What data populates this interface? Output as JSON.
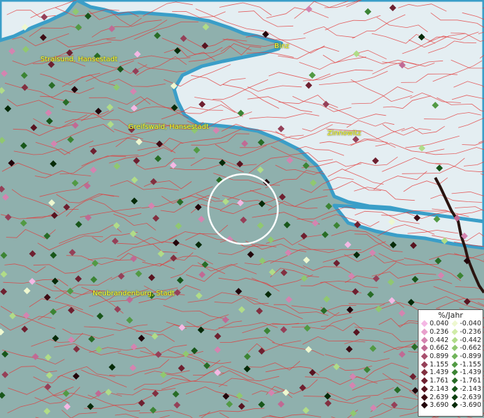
{
  "places": [
    {
      "name": "Stralsund, Hansestadt"
    },
    {
      "name": "Binz"
    },
    {
      "name": "Greifswald, Hansestadt"
    },
    {
      "name": "Zinnowitz"
    },
    {
      "name": "Neubrandenburg, Stadt"
    }
  ],
  "legend": {
    "title": "%/Jahr",
    "positive": [
      {
        "label": "0.040",
        "color": "#f4b8e4"
      },
      {
        "label": "0.236",
        "color": "#e8a0cc"
      },
      {
        "label": "0.442",
        "color": "#d484b0"
      },
      {
        "label": "0.662",
        "color": "#c06a94"
      },
      {
        "label": "0.899",
        "color": "#a8506e"
      },
      {
        "label": "1.155",
        "color": "#954058"
      },
      {
        "label": "1.439",
        "color": "#823040"
      },
      {
        "label": "1.761",
        "color": "#6e2030"
      },
      {
        "label": "2.143",
        "color": "#581420"
      },
      {
        "label": "2.639",
        "color": "#3e0c14"
      },
      {
        "label": "3.690",
        "color": "#22040a"
      }
    ],
    "negative": [
      {
        "label": "-0.040",
        "color": "#eef8d0"
      },
      {
        "label": "-0.236",
        "color": "#d0eca8"
      },
      {
        "label": "-0.442",
        "color": "#b0dc88"
      },
      {
        "label": "-0.662",
        "color": "#90c870"
      },
      {
        "label": "-0.899",
        "color": "#70b45a"
      },
      {
        "label": "-1.155",
        "color": "#529a44"
      },
      {
        "label": "-1.439",
        "color": "#3c8434"
      },
      {
        "label": "-1.761",
        "color": "#286c26"
      },
      {
        "label": "-2.143",
        "color": "#18561a"
      },
      {
        "label": "-2.639",
        "color": "#0c4010"
      },
      {
        "label": "-3.690",
        "color": "#062a08"
      }
    ]
  },
  "colors": {
    "land": "#8fb0ad",
    "sea": "#e4eef2",
    "coast": "#3a9ec8",
    "boundary": "#e23a3a",
    "highlight_ring": "#ffffff",
    "border_line": "#2a1410"
  },
  "markers": [
    {
      "v": 0.9
    },
    {
      "v": -0.5
    },
    {
      "v": -2.1
    },
    {
      "v": 0.3
    },
    {
      "v": -1.2
    },
    {
      "v": 1.6
    },
    {
      "v": -0.04
    },
    {
      "v": 2.6
    },
    {
      "v": -0.9
    },
    {
      "v": 0.66
    },
    {
      "v": -1.76
    },
    {
      "v": 1.15
    },
    {
      "v": -0.24
    },
    {
      "v": 3.69
    },
    {
      "v": -2.64
    },
    {
      "v": 0.44
    },
    {
      "v": -0.66
    },
    {
      "v": 1.44
    },
    {
      "v": -1.44
    },
    {
      "v": 0.04
    },
    {
      "v": -3.69
    },
    {
      "v": 2.14
    },
    {
      "v": -0.44
    },
    {
      "v": 0.24
    },
    {
      "v": -1.16
    },
    {
      "v": 1.76
    },
    {
      "v": -2.14
    },
    {
      "v": 0.9
    },
    {
      "v": -0.9
    },
    {
      "v": 0.66
    },
    {
      "v": -0.24
    },
    {
      "v": 1.16
    },
    {
      "v": -1.76
    },
    {
      "v": 2.64
    },
    {
      "v": -0.66
    },
    {
      "v": 0.44
    },
    {
      "v": -0.04
    },
    {
      "v": 1.44
    },
    {
      "v": -2.64
    },
    {
      "v": 0.24
    },
    {
      "v": -1.44
    },
    {
      "v": 3.69
    },
    {
      "v": -0.44
    },
    {
      "v": 0.04
    },
    {
      "v": -3.69
    },
    {
      "v": 1.76
    },
    {
      "v": -1.16
    },
    {
      "v": 0.9
    },
    {
      "v": -0.9
    },
    {
      "v": 2.14
    },
    {
      "v": -2.14
    },
    {
      "v": 0.66
    },
    {
      "v": -0.24
    },
    {
      "v": 1.16
    },
    {
      "v": -0.66
    },
    {
      "v": 0.44
    }
  ]
}
